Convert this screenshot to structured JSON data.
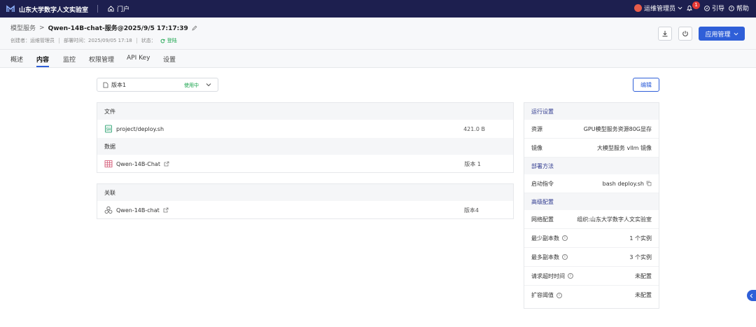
{
  "topbar": {
    "brand": "山东大学数字人文实验室",
    "portal_label": "门户",
    "user_name": "运维管理员",
    "notification_count": "1",
    "guide_label": "引导",
    "help_label": "帮助"
  },
  "header": {
    "breadcrumb_parent": "模型服务",
    "breadcrumb_sep": ">",
    "breadcrumb_current": "Qwen-14B-chat-服务@2025/9/5 17:17:39",
    "creator": "创建者：运维管理员",
    "deploy_time": "部署时间：2025/09/05 17:18",
    "status_label": "状态：",
    "status_value": "登陆",
    "app_manage_label": "应用管理"
  },
  "tabs": [
    {
      "label": "概述"
    },
    {
      "label": "内容"
    },
    {
      "label": "监控"
    },
    {
      "label": "权限管理"
    },
    {
      "label": "API Key"
    },
    {
      "label": "设置"
    }
  ],
  "active_tab": "内容",
  "version": {
    "label": "版本1",
    "status": "使用中"
  },
  "edit_label": "编辑",
  "files_panel": {
    "files_header": "文件",
    "file_name": "project/deploy.sh",
    "file_size": "421.0 B",
    "data_header": "数据",
    "data_name": "Qwen-14B-Chat",
    "data_version": "版本 1"
  },
  "related_panel": {
    "header": "关联",
    "name": "Qwen-14B-chat",
    "version": "版本4"
  },
  "settings": {
    "run_header": "运行设置",
    "resource_key": "资源",
    "resource_val": "GPU模型服务资源80G显存",
    "image_key": "镜像",
    "image_val": "大模型服务 vllm 镜像",
    "deploy_header": "部署方法",
    "cmd_key": "启动指令",
    "cmd_val": "bash deploy.sh",
    "advanced_header": "高级配置",
    "network_key": "网络配置",
    "network_val": "组织:山东大学数字人文实验室",
    "min_key": "最少副本数",
    "min_val": "1 个实例",
    "max_key": "最多副本数",
    "max_val": "3 个实例",
    "timeout_key": "请求超时时间",
    "timeout_val": "未配置",
    "scale_key": "扩容阈值",
    "scale_val": "未配置"
  },
  "colors": {
    "topbar": "#1d1f4f",
    "accent": "#2f5fd8",
    "success": "#16a34a",
    "badge": "#e53935"
  }
}
